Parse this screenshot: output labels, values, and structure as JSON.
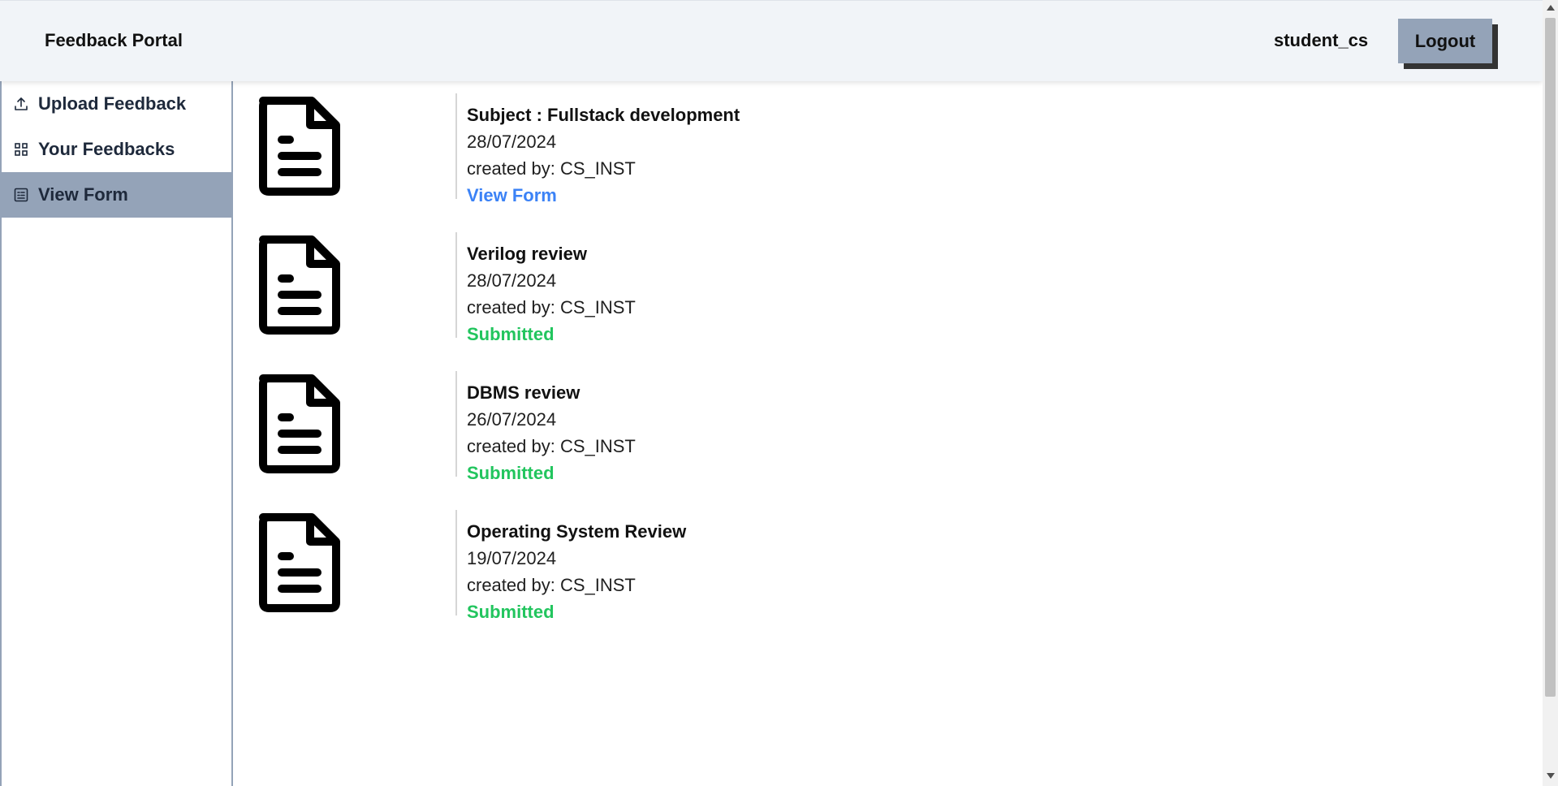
{
  "header": {
    "brand": "Feedback Portal",
    "username": "student_cs",
    "logout_label": "Logout"
  },
  "sidebar": {
    "items": [
      {
        "label": "Upload Feedback",
        "icon": "upload-icon",
        "active": false
      },
      {
        "label": "Your Feedbacks",
        "icon": "grid-icon",
        "active": false
      },
      {
        "label": "View Form",
        "icon": "form-icon",
        "active": true
      }
    ]
  },
  "forms": [
    {
      "title": "Subject : Fullstack development",
      "date": "28/07/2024",
      "created_by": "created by: CS_INST",
      "status": "View Form",
      "status_type": "link"
    },
    {
      "title": "Verilog review",
      "date": "28/07/2024",
      "created_by": "created by: CS_INST",
      "status": "Submitted",
      "status_type": "submitted"
    },
    {
      "title": "DBMS review",
      "date": "26/07/2024",
      "created_by": "created by: CS_INST",
      "status": "Submitted",
      "status_type": "submitted"
    },
    {
      "title": "Operating System Review",
      "date": "19/07/2024",
      "created_by": "created by: CS_INST",
      "status": "Submitted",
      "status_type": "submitted"
    }
  ],
  "colors": {
    "accent": "#94a3b8",
    "link": "#3b82f6",
    "submitted": "#22c55e",
    "header_bg": "#f1f4f8"
  }
}
